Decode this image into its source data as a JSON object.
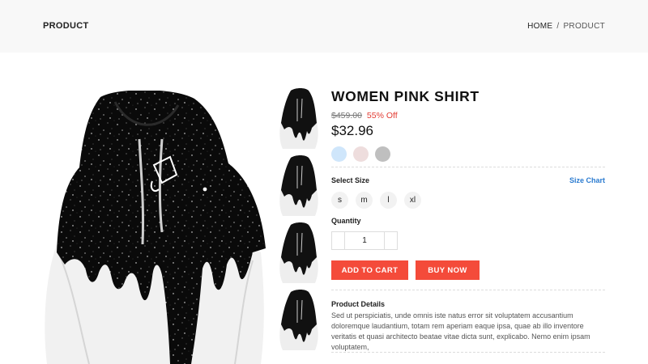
{
  "header": {
    "title": "PRODUCT",
    "breadcrumb": {
      "home": "HOME",
      "separator": "/",
      "current": "PRODUCT"
    }
  },
  "product": {
    "name": "WOMEN PINK SHIRT",
    "old_price": "$459.00",
    "discount": "55% Off",
    "price": "$32.96",
    "colors": [
      "#cfe6fb",
      "#eedddd",
      "#bfbfbf"
    ],
    "select_size_label": "Select Size",
    "size_chart_label": "Size Chart",
    "sizes": [
      "s",
      "m",
      "l",
      "xl"
    ],
    "quantity_label": "Quantity",
    "quantity": "1",
    "add_to_cart_label": "ADD TO CART",
    "buy_now_label": "BUY NOW",
    "details_label": "Product Details",
    "details_text": "Sed ut perspiciatis, unde omnis iste natus error sit voluptatem accusantium doloremque laudantium, totam rem aperiam eaque ipsa, quae ab illo inventore veritatis et quasi architecto beatae vitae dicta sunt, explicabo. Nemo enim ipsam voluptatem,",
    "image_icon": "hoodie-image",
    "thumbnail_count": 4
  },
  "colors": {
    "accent": "#f44b3a",
    "link": "#2b7bd0",
    "discount": "#e23c33"
  }
}
